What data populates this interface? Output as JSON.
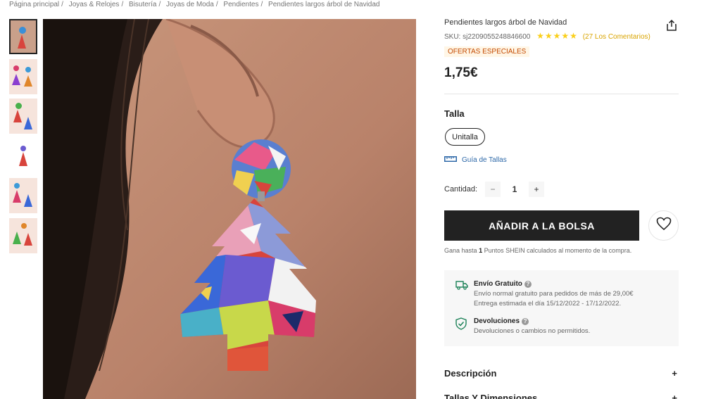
{
  "breadcrumb": [
    {
      "label": "Página principal"
    },
    {
      "label": "Joyas & Relojes"
    },
    {
      "label": "Bisutería"
    },
    {
      "label": "Joyas de Moda"
    },
    {
      "label": "Pendientes"
    },
    {
      "label": "Pendientes largos árbol de Navidad"
    }
  ],
  "product": {
    "title": "Pendientes largos árbol de Navidad",
    "sku": "SKU: sj2209055248846600",
    "rating_stars": "★★★★★",
    "reviews": "(27 Los Comentarios)",
    "promo": "OFERTAS ESPECIALES",
    "price": "1,75€"
  },
  "size": {
    "label": "Talla",
    "options": [
      "Unitalla"
    ],
    "guide": "Guía de Tallas"
  },
  "quantity": {
    "label": "Cantidad:",
    "minus": "−",
    "value": "1",
    "plus": "+"
  },
  "actions": {
    "add_to_bag": "AÑADIR A LA BOLSA"
  },
  "points": {
    "prefix": "Gana hasta",
    "value": "1",
    "suffix": "Puntos SHEIN calculados al momento de la compra."
  },
  "shipping": {
    "title": "Envío Gratuito",
    "line1": "Envío normal gratuito para pedidos de más de 29,00€",
    "line2": "Entrega estimada el día 15/12/2022 - 17/12/2022."
  },
  "returns": {
    "title": "Devoluciones",
    "line1": "Devoluciones o cambios no permitidos."
  },
  "accordions": [
    {
      "label": "Descripción",
      "sign": "+"
    },
    {
      "label": "Tallas Y Dimensiones",
      "sign": "+"
    }
  ],
  "icons": {
    "share": "share-icon",
    "heart": "heart-icon",
    "ruler": "ruler-icon",
    "truck": "truck-icon",
    "shield": "shield-check-icon",
    "help": "help-icon"
  },
  "colors": {
    "accent_dark": "#222222",
    "star": "#facf19",
    "promo_bg": "#fff6e6",
    "promo_text": "#c44a01",
    "link": "#2d68a8",
    "ship_green": "#1b8157"
  }
}
